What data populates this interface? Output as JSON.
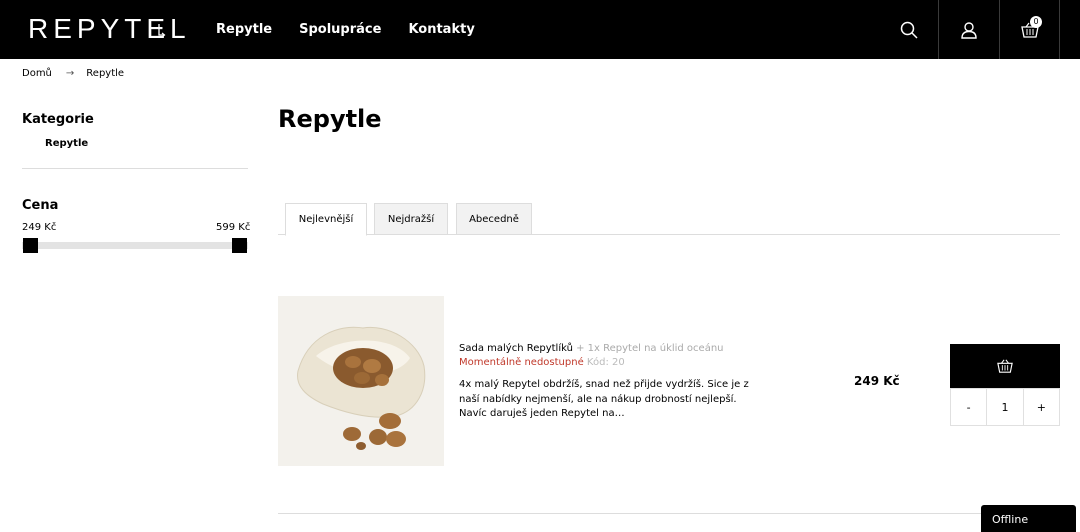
{
  "header": {
    "logo": "REPYTEL",
    "nav": [
      "Repytle",
      "Spolupráce",
      "Kontakty"
    ],
    "cart_count": "0",
    "icons": [
      "search-icon",
      "user-icon",
      "cart-icon"
    ]
  },
  "breadcrumb": {
    "home": "Domů",
    "current": "Repytle"
  },
  "sidebar": {
    "categories_title": "Kategorie",
    "categories": [
      "Repytle"
    ],
    "price_title": "Cena",
    "price_min": "249 Kč",
    "price_max": "599 Kč"
  },
  "main": {
    "title": "Repytle",
    "tabs": [
      "Nejlevnější",
      "Nejdražší",
      "Abecedně"
    ],
    "active_tab": "Nejlevnější"
  },
  "product": {
    "name": "Sada malých Repytlíků",
    "name_extra": " + 1x Repytel na úklid oceánu",
    "availability": "Momentálně nedostupné",
    "code": " Kód: 20",
    "description": "4x malý Repytel obdržíš, snad než přijde vydržíš. Sice je z naší nabídky nejmenší, ale na nákup drobností nejlepší. Navíc daruješ jeden Repytel na…",
    "price": "249 Kč",
    "qty_minus": "-",
    "qty_value": "1",
    "qty_plus": "+"
  },
  "chat": {
    "status": "Offline"
  },
  "colors": {
    "header_bg": "#000000",
    "unavailable": "#c0392b",
    "muted": "#aaaaaa"
  }
}
